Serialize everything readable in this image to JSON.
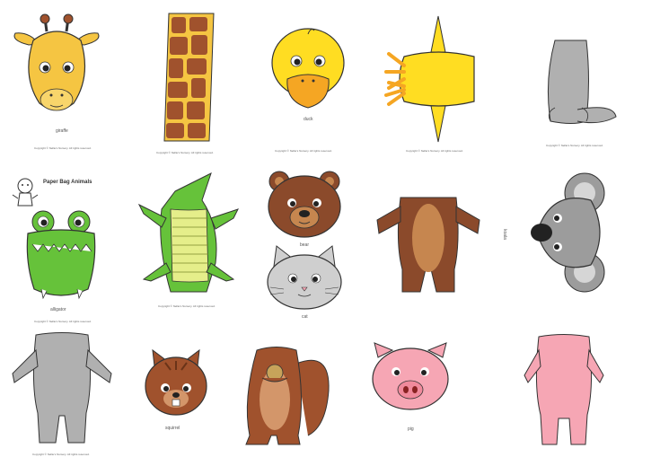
{
  "sheet_title": "Paper Bag Animals",
  "copyright": "Copyright © Nellie's Nursery. All rights reserved.",
  "labels": {
    "giraffe": "giraffe",
    "duck": "duck",
    "bear": "bear",
    "cat": "cat",
    "koala": "koala",
    "alligator": "alligator",
    "squirrel": "squirrel",
    "pig": "pig"
  },
  "colors": {
    "giraffe": "#f5c542",
    "giraffe_pattern": "#a0522d",
    "duck": "#ffdd22",
    "duck_bill": "#f5a623",
    "bear": "#8b4a2b",
    "bear_light": "#c6864f",
    "cat": "#cfcfcf",
    "koala": "#9c9c9c",
    "gray_body": "#b0b0b0",
    "alligator": "#66c23a",
    "alligator_belly": "#e5ee8a",
    "squirrel": "#a0522d",
    "squirrel_light": "#d3966a",
    "pig": "#f6a6b4"
  }
}
